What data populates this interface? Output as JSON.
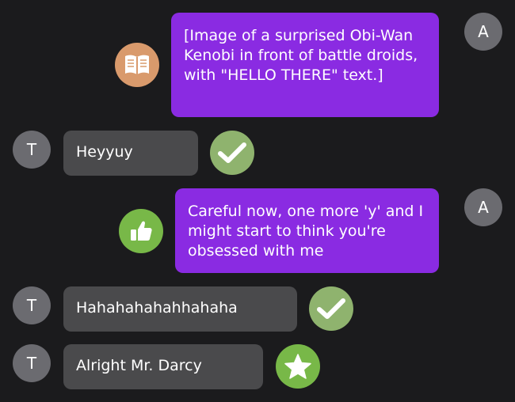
{
  "messages": [
    {
      "sender": "outgoing",
      "avatar_initial": "A",
      "text": "[Image of a surprised Obi-Wan Kenobi in front of battle droids, with \"HELLO THERE\" text.]",
      "reaction": {
        "icon": "open-book-icon",
        "color": "#d99a6c"
      }
    },
    {
      "sender": "incoming",
      "avatar_initial": "T",
      "text": "Heyyuy",
      "reaction": {
        "icon": "check-icon",
        "color": "#8fb36e"
      }
    },
    {
      "sender": "outgoing",
      "avatar_initial": "A",
      "text": "Careful now, one more 'y' and I might start to think you're obsessed with me",
      "reaction": {
        "icon": "thumbs-up-icon",
        "color": "#78b848"
      }
    },
    {
      "sender": "incoming",
      "avatar_initial": "T",
      "text": "Hahahahahahhahaha",
      "reaction": {
        "icon": "check-icon",
        "color": "#8fb36e"
      }
    },
    {
      "sender": "incoming",
      "avatar_initial": "T",
      "text": "Alright Mr. Darcy",
      "reaction": {
        "icon": "star-icon",
        "color": "#78b848"
      }
    }
  ],
  "colors": {
    "background": "#1b1b1d",
    "outgoing_bubble": "#8a2be2",
    "incoming_bubble": "#4a4a4c",
    "avatar": "#6b6b70"
  }
}
